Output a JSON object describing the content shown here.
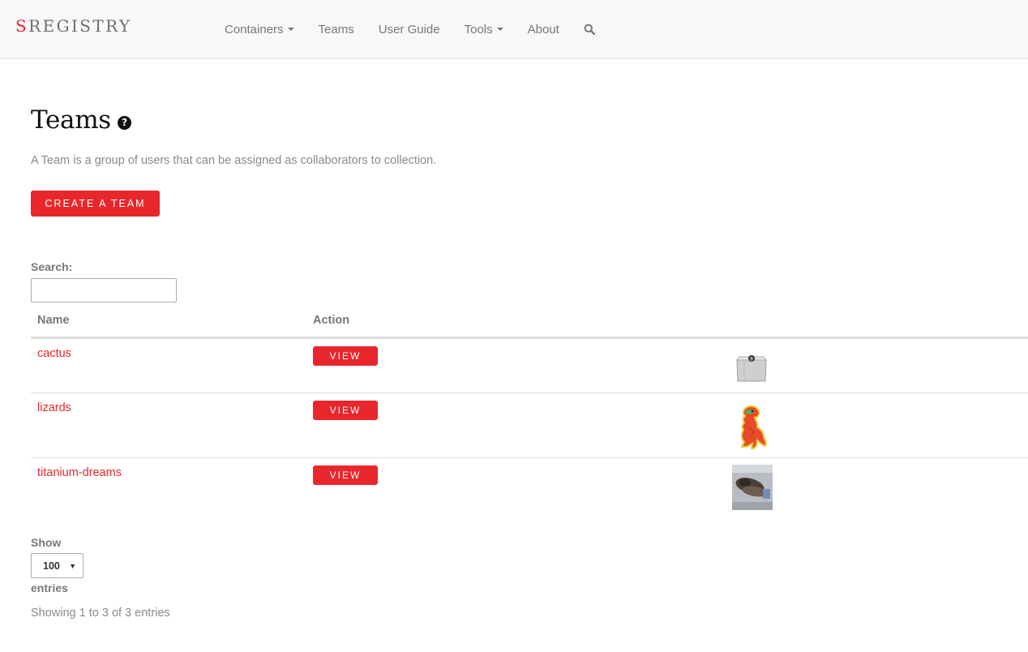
{
  "brand": {
    "first_letter": "S",
    "rest": "REGISTRY",
    "accent_color": "#e8272c"
  },
  "nav": {
    "items": [
      {
        "label": "Containers",
        "dropdown": true
      },
      {
        "label": "Teams",
        "dropdown": false
      },
      {
        "label": "User Guide",
        "dropdown": false
      },
      {
        "label": "Tools",
        "dropdown": true
      },
      {
        "label": "About",
        "dropdown": false
      }
    ],
    "search_icon": "search-icon"
  },
  "page": {
    "title": "Teams",
    "help_icon": "question-circle-icon",
    "description": "A Team is a group of users that can be assigned as collaborators to collection.",
    "create_button": "Create a Team"
  },
  "search": {
    "label": "Search:",
    "value": ""
  },
  "table": {
    "headers": {
      "name": "Name",
      "action": "Action"
    },
    "rows": [
      {
        "name": "cactus",
        "action": "View",
        "avatar": "box-image"
      },
      {
        "name": "lizards",
        "action": "View",
        "avatar": "dinosaur-image"
      },
      {
        "name": "titanium-dreams",
        "action": "View",
        "avatar": "photo-thumbnail"
      }
    ]
  },
  "length": {
    "label_before": "Show",
    "value": "100",
    "label_after": "entries"
  },
  "info": "Showing 1 to 3 of 3 entries"
}
